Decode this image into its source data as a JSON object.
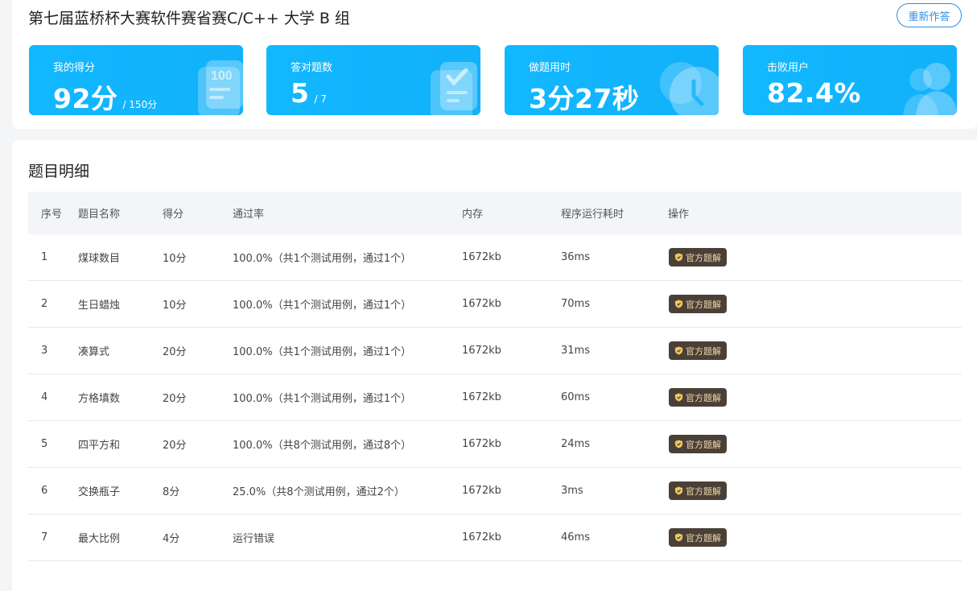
{
  "header": {
    "title": "第七届蓝桥杯大赛软件赛省赛C/C++ 大学 B 组",
    "redo_label": "重新作答"
  },
  "stats": [
    {
      "label": "我的得分",
      "value": "92分",
      "sub": "/ 150分",
      "icon": "score-100-icon"
    },
    {
      "label": "答对题数",
      "value": "5",
      "sub": "/ 7",
      "icon": "checklist-icon"
    },
    {
      "label": "做题用时",
      "value": "3分27秒",
      "sub": "",
      "icon": "clock-icon"
    },
    {
      "label": "击败用户",
      "value": "82.4%",
      "sub": "",
      "icon": "users-icon"
    }
  ],
  "detail": {
    "title": "题目明细",
    "columns": [
      "序号",
      "题目名称",
      "得分",
      "通过率",
      "内存",
      "程序运行耗时",
      "操作"
    ],
    "rows": [
      {
        "no": "1",
        "name": "煤球数目",
        "score": "10分",
        "rate": "100.0%（共1个测试用例，通过1个）",
        "mem": "1672kb",
        "time": "36ms",
        "action": "官方题解"
      },
      {
        "no": "2",
        "name": "生日蜡烛",
        "score": "10分",
        "rate": "100.0%（共1个测试用例，通过1个）",
        "mem": "1672kb",
        "time": "70ms",
        "action": "官方题解"
      },
      {
        "no": "3",
        "name": "凑算式",
        "score": "20分",
        "rate": "100.0%（共1个测试用例，通过1个）",
        "mem": "1672kb",
        "time": "31ms",
        "action": "官方题解"
      },
      {
        "no": "4",
        "name": "方格填数",
        "score": "20分",
        "rate": "100.0%（共1个测试用例，通过1个）",
        "mem": "1672kb",
        "time": "60ms",
        "action": "官方题解"
      },
      {
        "no": "5",
        "name": "四平方和",
        "score": "20分",
        "rate": "100.0%（共8个测试用例，通过8个）",
        "mem": "1672kb",
        "time": "24ms",
        "action": "官方题解"
      },
      {
        "no": "6",
        "name": "交换瓶子",
        "score": "8分",
        "rate": "25.0%（共8个测试用例，通过2个）",
        "mem": "1672kb",
        "time": "3ms",
        "action": "官方题解"
      },
      {
        "no": "7",
        "name": "最大比例",
        "score": "4分",
        "rate": "运行错误",
        "mem": "1672kb",
        "time": "46ms",
        "action": "官方题解"
      }
    ]
  },
  "colors": {
    "stat_bg": "#12b8ff",
    "accent": "#2f8ce8",
    "solution_btn": "#4a4037"
  }
}
